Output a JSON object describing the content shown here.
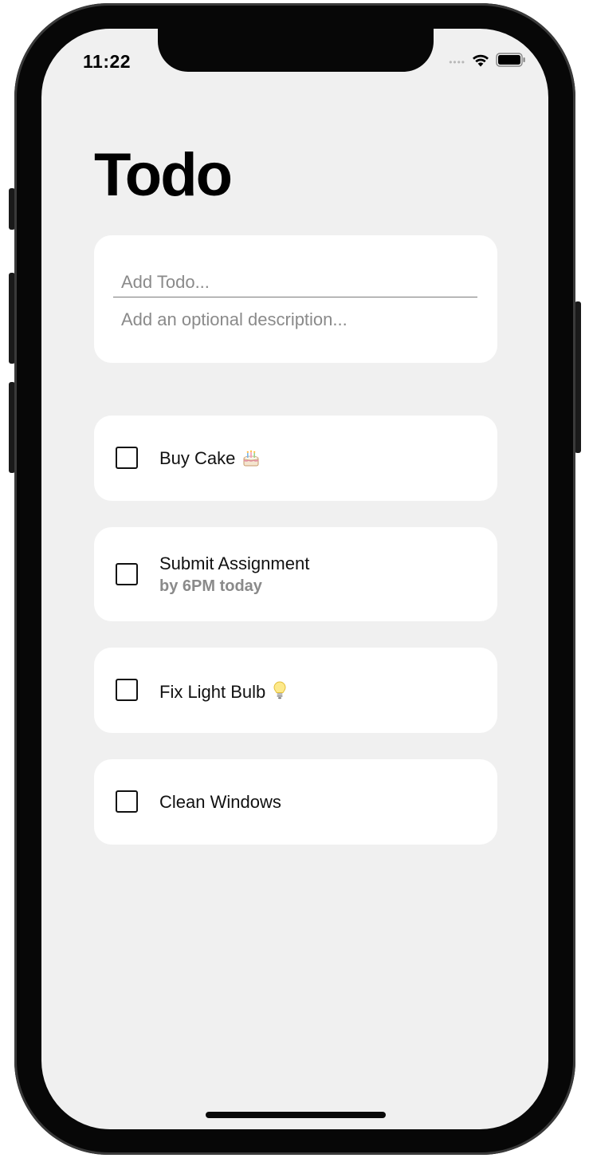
{
  "status_bar": {
    "time": "11:22",
    "signal_icon": "signal-dots-icon",
    "wifi_icon": "wifi-icon",
    "battery_icon": "battery-icon"
  },
  "header": {
    "title": "Todo"
  },
  "new_todo": {
    "title_placeholder": "Add Todo...",
    "title_value": "",
    "description_placeholder": "Add an optional description...",
    "description_value": ""
  },
  "todos": [
    {
      "title": "Buy Cake",
      "subtitle": "",
      "checked": false,
      "icon": "birthday-cake-icon"
    },
    {
      "title": "Submit Assignment",
      "subtitle": "by 6PM today",
      "checked": false,
      "icon": ""
    },
    {
      "title": "Fix Light Bulb",
      "subtitle": "",
      "checked": false,
      "icon": "light-bulb-icon"
    },
    {
      "title": "Clean Windows",
      "subtitle": "",
      "checked": false,
      "icon": ""
    }
  ],
  "colors": {
    "background": "#f0f0f0",
    "card": "#ffffff",
    "subtitle": "#8a8a8a"
  }
}
